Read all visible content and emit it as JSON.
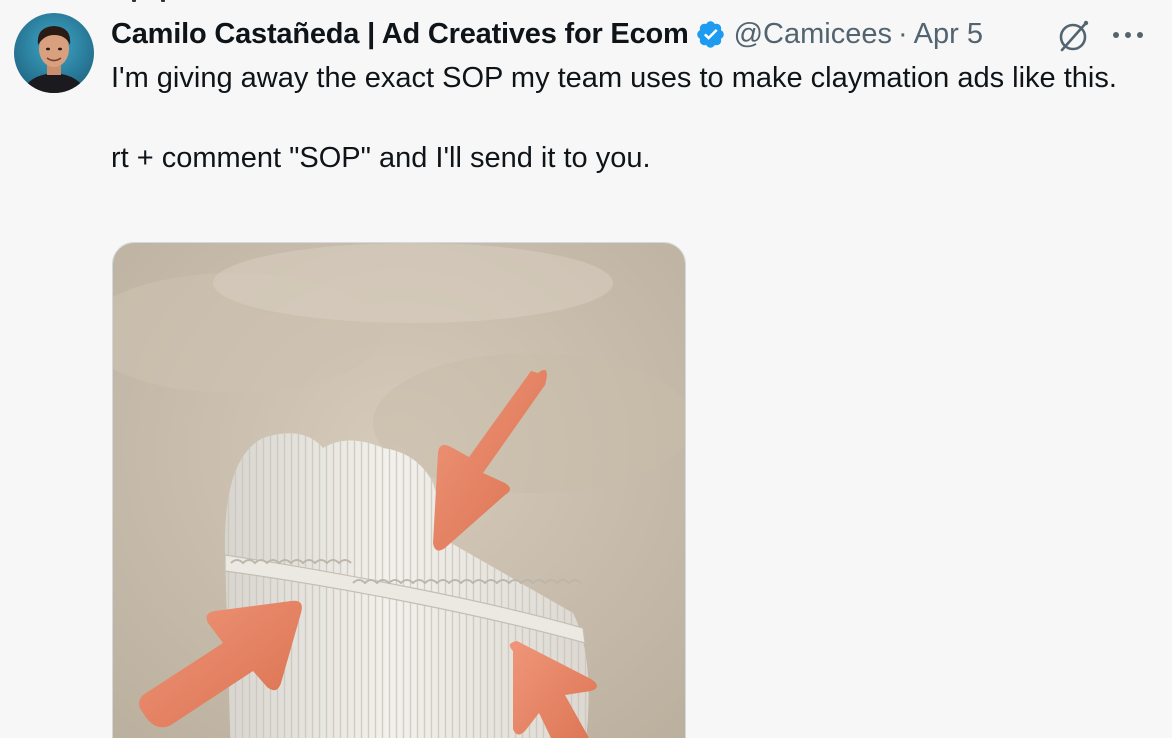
{
  "tweet": {
    "author": {
      "display_name": "Camilo Castañeda | Ad Creatives for Ecom",
      "handle": "@Camicees",
      "verified": true,
      "avatar_icon": "profile-photo"
    },
    "separator": "·",
    "date": "Apr 5",
    "text_lines": [
      "I'm giving away the exact SOP my team uses to make claymation ads like this.",
      "rt + comment \"SOP\" and I'll send it to you."
    ],
    "media": {
      "kind": "image",
      "icon": "claymation-ad-image"
    },
    "actions": {
      "grok_icon": "grok-icon",
      "more_icon": "more-icon"
    }
  },
  "colors": {
    "background": "#f7f7f7",
    "text_primary": "#0f1419",
    "text_secondary": "#536471",
    "verified_blue": "#1d9bf0",
    "clay_orange": "#e8876a",
    "clay_background": "#cfc3b3"
  }
}
